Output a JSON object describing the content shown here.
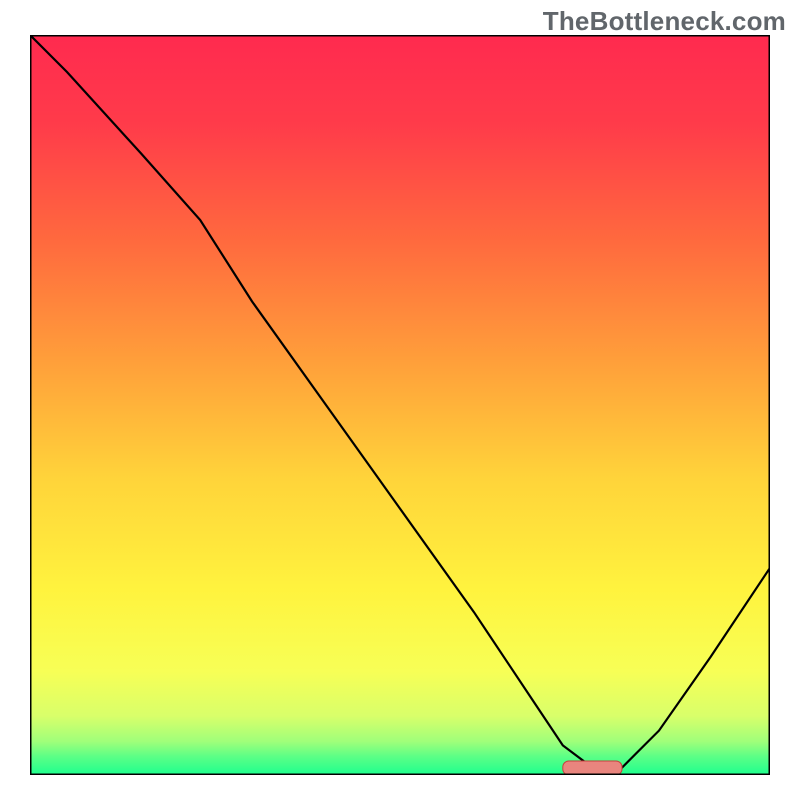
{
  "watermark": "TheBottleneck.com",
  "chart_data": {
    "type": "line",
    "title": "",
    "xlabel": "",
    "ylabel": "",
    "xlim": [
      0,
      100
    ],
    "ylim": [
      0,
      100
    ],
    "x": [
      0,
      5,
      15,
      23,
      30,
      40,
      50,
      60,
      68,
      72,
      76,
      80,
      85,
      92,
      100
    ],
    "values": [
      100,
      95,
      84,
      75,
      64,
      50,
      36,
      22,
      10,
      4,
      1,
      1,
      6,
      16,
      28
    ],
    "marker": {
      "x_start": 72,
      "x_end": 80,
      "y": 0
    },
    "gradient_stops": [
      {
        "offset": 0.0,
        "color": "#ff2a4f"
      },
      {
        "offset": 0.12,
        "color": "#ff3b4a"
      },
      {
        "offset": 0.28,
        "color": "#ff6a3e"
      },
      {
        "offset": 0.45,
        "color": "#ffa23a"
      },
      {
        "offset": 0.6,
        "color": "#ffd43a"
      },
      {
        "offset": 0.75,
        "color": "#fff33e"
      },
      {
        "offset": 0.86,
        "color": "#f7ff56"
      },
      {
        "offset": 0.92,
        "color": "#d9ff6a"
      },
      {
        "offset": 0.955,
        "color": "#9fff7a"
      },
      {
        "offset": 0.975,
        "color": "#5cff86"
      },
      {
        "offset": 1.0,
        "color": "#1dff8e"
      }
    ],
    "colors": {
      "frame": "#000000",
      "curve": "#000000",
      "marker_fill": "#e9857e",
      "marker_stroke": "#c5403d"
    }
  }
}
